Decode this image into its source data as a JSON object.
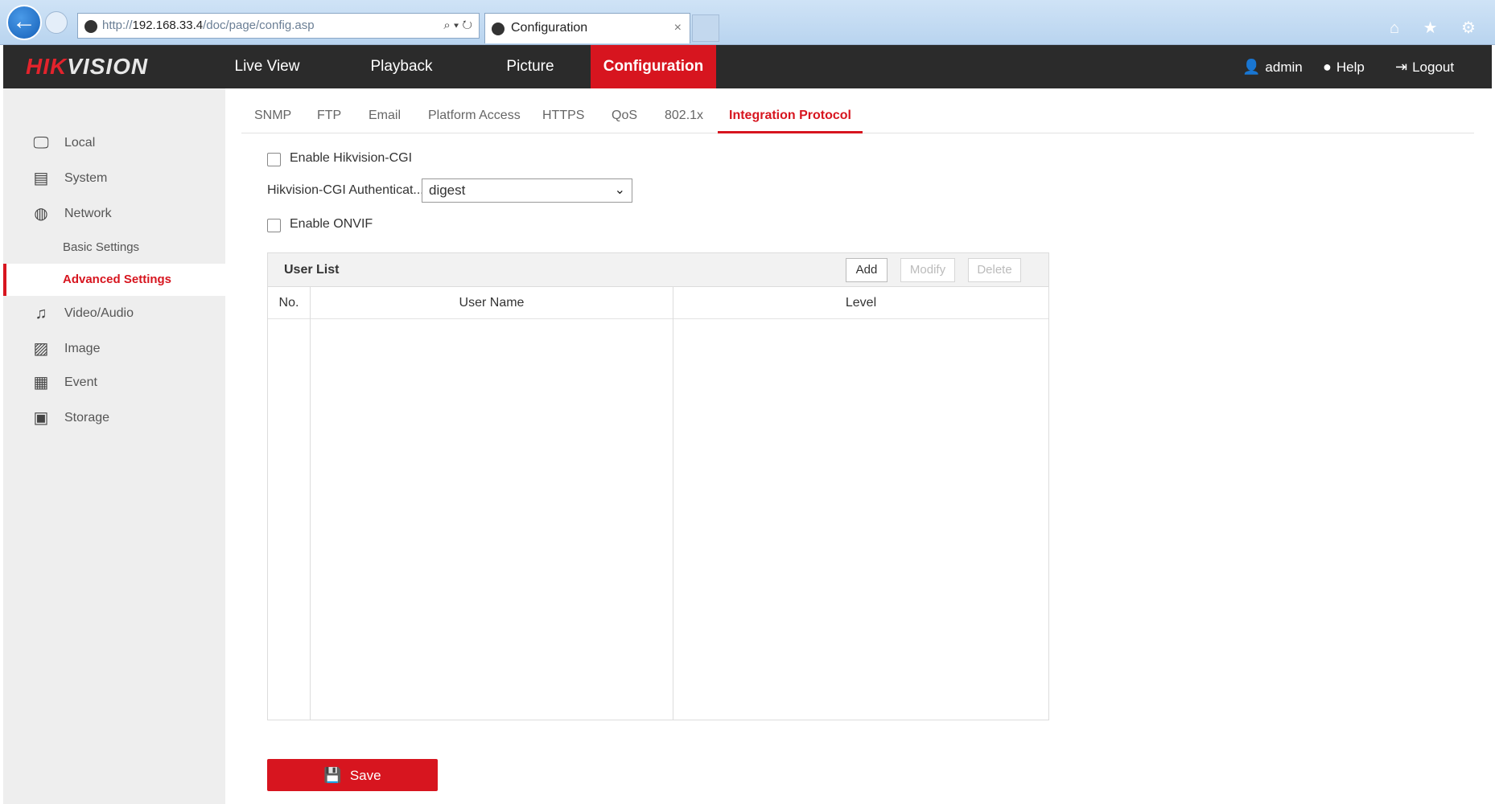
{
  "browser": {
    "address_prefix": "http://",
    "address_host": "192.168.33.4",
    "address_path": "/doc/page/config.asp",
    "address_tools": "⌕ ▾ ↻",
    "tab_title": "Configuration",
    "tab_close": "×",
    "right_icons": "⌂ ★ ⚙"
  },
  "header": {
    "logo_red": "HIK",
    "logo_white": "VISION",
    "nav": [
      "Live View",
      "Playback",
      "Picture",
      "Configuration"
    ],
    "user": "admin",
    "help": "Help",
    "logout": "Logout"
  },
  "sidebar": {
    "items": [
      {
        "label": "Local",
        "icon": "monitor-icon"
      },
      {
        "label": "System",
        "icon": "system-icon"
      },
      {
        "label": "Network",
        "icon": "globe-icon"
      },
      {
        "label": "Basic Settings"
      },
      {
        "label": "Advanced Settings"
      },
      {
        "label": "Video/Audio",
        "icon": "video-audio-icon"
      },
      {
        "label": "Image",
        "icon": "image-icon"
      },
      {
        "label": "Event",
        "icon": "event-icon"
      },
      {
        "label": "Storage",
        "icon": "storage-icon"
      }
    ]
  },
  "subtabs": [
    "SNMP",
    "FTP",
    "Email",
    "Platform Access",
    "HTTPS",
    "QoS",
    "802.1x",
    "Integration Protocol"
  ],
  "form": {
    "enable_cgi_label": "Enable Hikvision-CGI",
    "auth_label": "Hikvision-CGI Authenticat...",
    "auth_value": "digest",
    "enable_onvif_label": "Enable ONVIF"
  },
  "user_list": {
    "title": "User List",
    "add": "Add",
    "modify": "Modify",
    "delete": "Delete",
    "col_no": "No.",
    "col_name": "User Name",
    "col_level": "Level"
  },
  "save_label": "Save",
  "colors": {
    "accent": "#d7151f",
    "header_bg": "#2b2b2b",
    "sidebar_bg": "#eeeeee"
  }
}
